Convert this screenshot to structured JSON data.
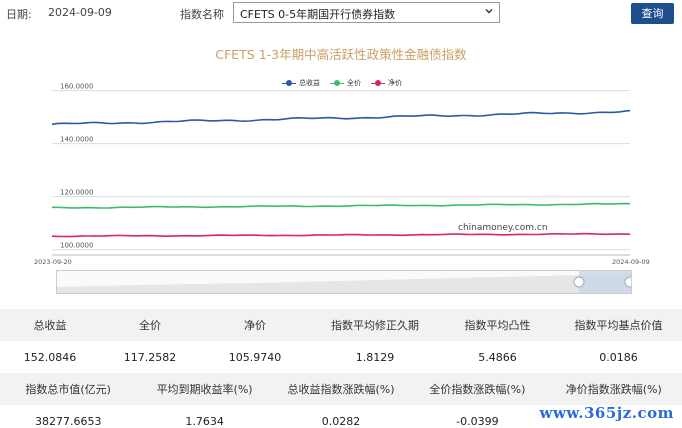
{
  "header": {
    "date_label": "日期:",
    "date_value": "2024-09-09",
    "index_label": "指数名称",
    "index_select_value": "CFETS 0-5年期国开行债券指数",
    "query_label": "查询"
  },
  "chart_data": {
    "type": "line",
    "title": "CFETS 1-3年期中高活跃性政策性金融债指数",
    "watermark": "chinamoney.com.cn",
    "x_start": "2023-09-20",
    "x_end": "2024-09-09",
    "ylim": [
      98,
      164
    ],
    "y_ticks": [
      "160.0000",
      "140.0000",
      "120.0000",
      "100.0000"
    ],
    "y_tick_values": [
      160,
      140,
      120,
      100
    ],
    "grid": true,
    "legend_placement": "top-center",
    "series": [
      {
        "name": "总收益",
        "color": "#2c5aa0",
        "start": 147.3,
        "end": 152.08
      },
      {
        "name": "全价",
        "color": "#3cbc6a",
        "start": 115.8,
        "end": 117.26
      },
      {
        "name": "净价",
        "color": "#d42a55",
        "start": 105.1,
        "end": 105.97
      }
    ]
  },
  "stats": {
    "row1_headers": [
      "总收益",
      "全价",
      "净价",
      "指数平均修正久期",
      "指数平均凸性",
      "指数平均基点价值"
    ],
    "row1_values": [
      "152.0846",
      "117.2582",
      "105.9740",
      "1.8129",
      "5.4866",
      "0.0186"
    ],
    "row2_headers": [
      "指数总市值(亿元)",
      "平均到期收益率(%)",
      "总收益指数涨跌幅(%)",
      "全价指数涨跌幅(%)",
      "净价指数涨跌幅(%)"
    ],
    "row2_values": [
      "38277.6653",
      "1.7634",
      "0.0282",
      "-0.0399",
      ""
    ]
  },
  "watermark_site": "www.365jz.com",
  "colors": {
    "accent": "#1f4e8c",
    "title": "#c8a164"
  }
}
